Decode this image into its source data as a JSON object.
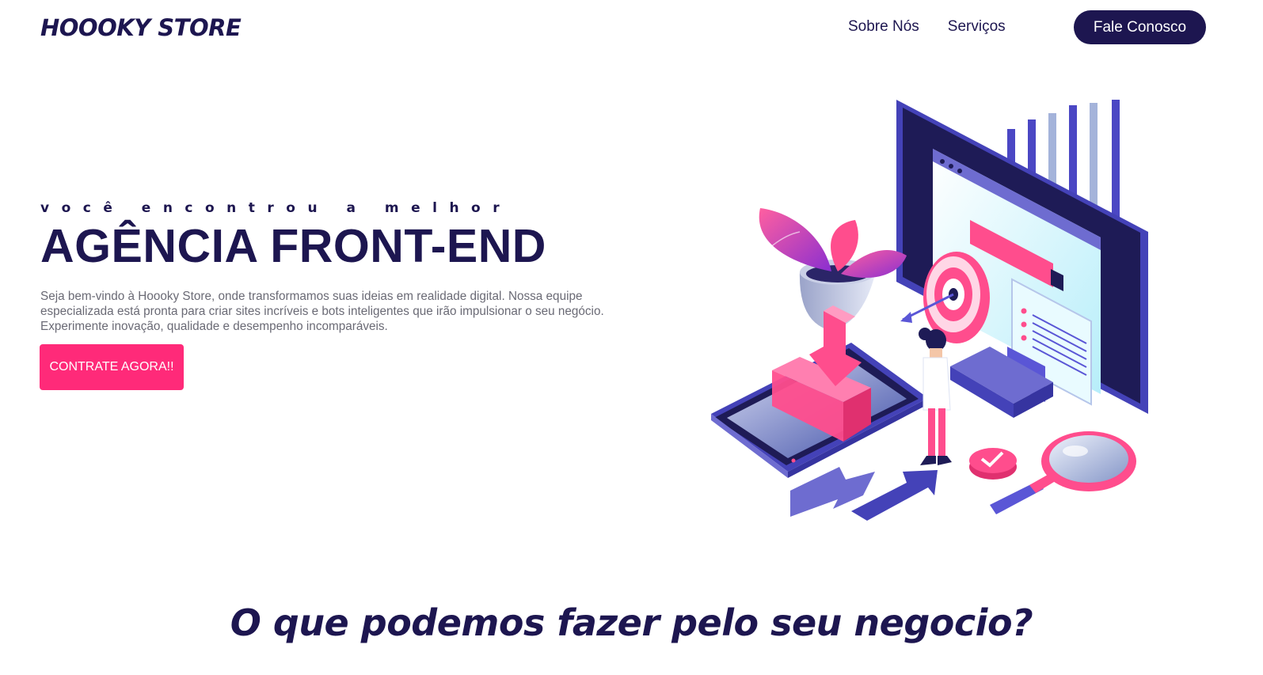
{
  "header": {
    "logo": "HOOOKY STORE",
    "nav": [
      {
        "label": "Sobre Nós"
      },
      {
        "label": "Serviços"
      }
    ],
    "contact_button": "Fale Conosco"
  },
  "hero": {
    "eyebrow": "você encontrou a melhor",
    "headline": "AGÊNCIA FRONT-END",
    "intro": "Seja bem-vindo à Hoooky Store, onde transformamos suas ideias em realidade digital. Nossa equipe especializada está pronta para criar sites incríveis e bots inteligentes que irão impulsionar o seu negócio. Experimente inovação, qualidade e desempenho incomparáveis.",
    "cta": "CONTRATE AGORA!!"
  },
  "services": {
    "title": "O que podemos fazer pelo seu negocio?"
  },
  "colors": {
    "brand_dark": "#1d1650",
    "accent_pink": "#ff2a79",
    "accent_purple": "#5a56d6",
    "text_muted": "#6a6a75"
  }
}
